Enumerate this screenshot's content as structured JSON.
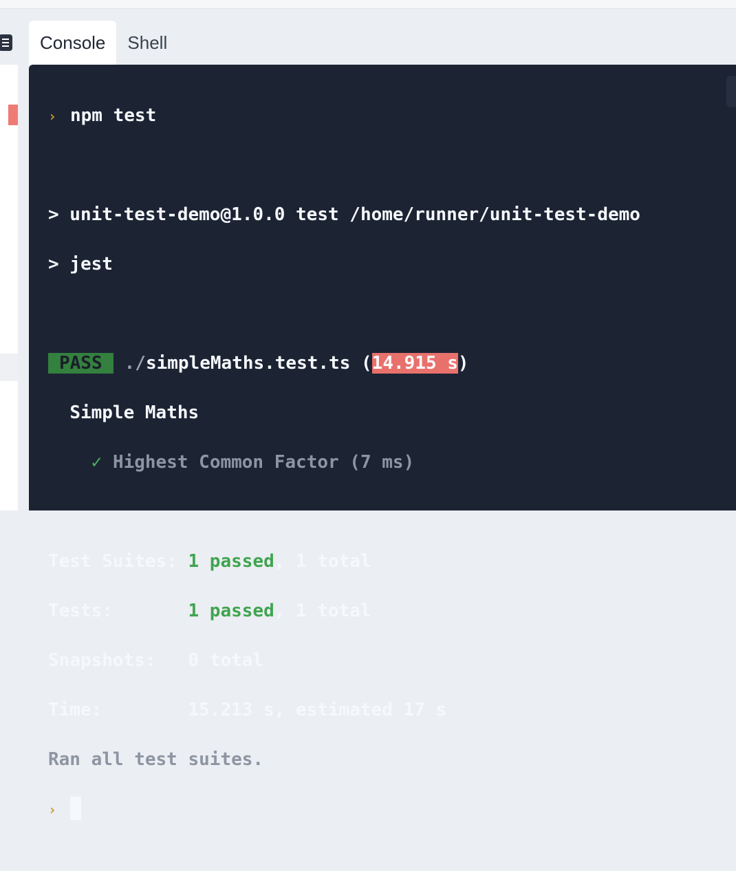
{
  "tabs": [
    {
      "label": "Console",
      "active": true
    },
    {
      "label": "Shell",
      "active": false
    }
  ],
  "terminal": {
    "prompt_glyph": "›",
    "command": "npm test",
    "script_header": "> unit-test-demo@1.0.0 test /home/runner/unit-test-demo",
    "script_cmd": "> jest",
    "pass_badge": "PASS",
    "test_file_prefix": "./",
    "test_file_name": "simpleMaths.test.ts",
    "paren_open": "(",
    "test_time": "14.915 s",
    "paren_close": ")",
    "describe_name": "Simple Maths",
    "check_mark": "✓",
    "test_case": "Highest Common Factor (7 ms)",
    "summary": {
      "suites_label": "Test Suites: ",
      "suites_passed": "1 passed",
      "suites_total": ", 1 total",
      "tests_label": "Tests:       ",
      "tests_passed": "1 passed",
      "tests_total": ", 1 total",
      "snapshots_label": "Snapshots:   ",
      "snapshots_value": "0 total",
      "time_label": "Time:        ",
      "time_value": "15.213 s, estimated 17 s"
    },
    "footer": "Ran all test suites."
  },
  "colors": {
    "terminal_bg": "#1c2333",
    "pass_green": "#33803f",
    "time_highlight": "#e8716c",
    "prompt": "#c99b2a"
  }
}
